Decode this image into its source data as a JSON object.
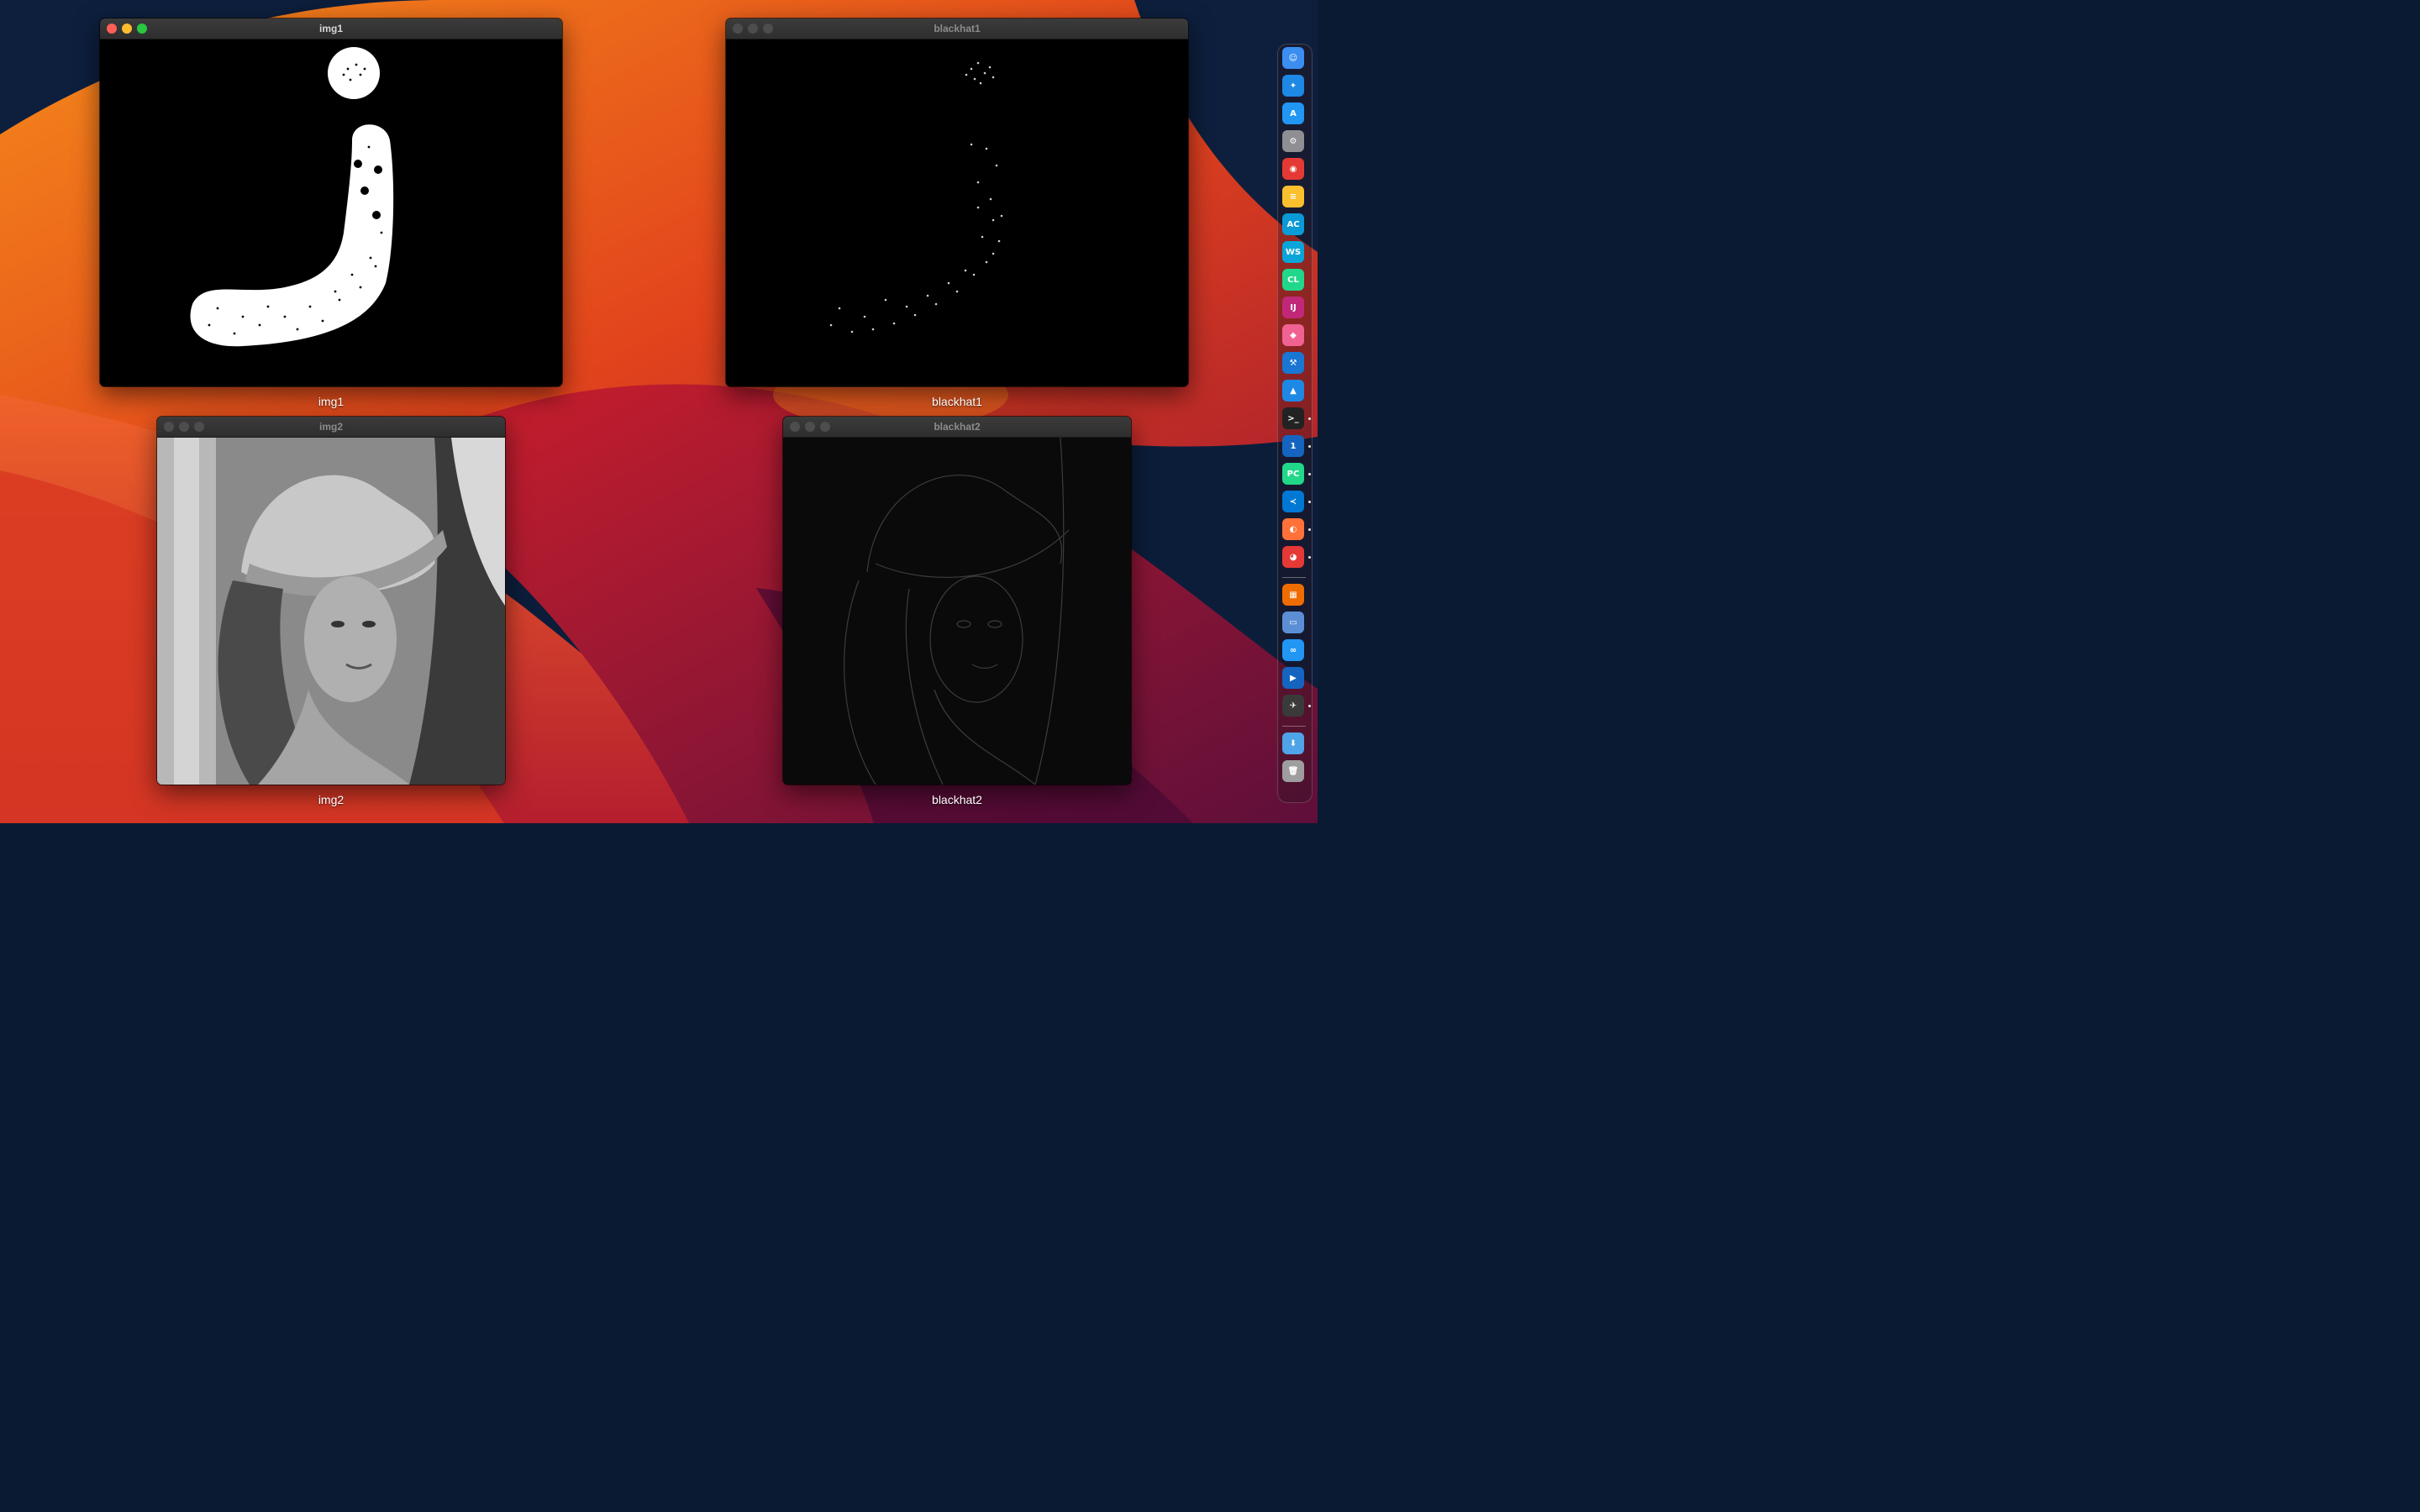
{
  "windows": [
    {
      "id": "img1",
      "title": "img1",
      "caption": "img1",
      "active": true
    },
    {
      "id": "blackhat1",
      "title": "blackhat1",
      "caption": "blackhat1",
      "active": false
    },
    {
      "id": "img2",
      "title": "img2",
      "caption": "img2",
      "active": false
    },
    {
      "id": "blackhat2",
      "title": "blackhat2",
      "caption": "blackhat2",
      "active": false
    }
  ],
  "dock": {
    "apps": [
      {
        "name": "finder",
        "glyph": "☺",
        "color": "#3b8df0",
        "running": false
      },
      {
        "name": "safari",
        "glyph": "✦",
        "color": "#1e88e5",
        "running": false
      },
      {
        "name": "app-store",
        "glyph": "A",
        "color": "#2196f3",
        "running": false
      },
      {
        "name": "system-settings",
        "glyph": "⚙",
        "color": "#8e8e93",
        "running": false
      },
      {
        "name": "chrome",
        "glyph": "◉",
        "color": "#e53935",
        "running": false
      },
      {
        "name": "notes",
        "glyph": "≡",
        "color": "#fbc02d",
        "running": false
      },
      {
        "name": "appcode",
        "glyph": "AC",
        "color": "#0a9ad6",
        "running": false
      },
      {
        "name": "webstorm",
        "glyph": "WS",
        "color": "#0aa5d8",
        "running": false
      },
      {
        "name": "clion",
        "glyph": "CL",
        "color": "#21d789",
        "running": false
      },
      {
        "name": "intellij-idea",
        "glyph": "IJ",
        "color": "#c1287a",
        "running": false
      },
      {
        "name": "cleanmymac",
        "glyph": "◆",
        "color": "#f06292",
        "running": false
      },
      {
        "name": "xcode",
        "glyph": "⚒",
        "color": "#1976d2",
        "running": false
      },
      {
        "name": "mweb",
        "glyph": "▲",
        "color": "#1e88e5",
        "running": false
      },
      {
        "name": "terminal",
        "glyph": ">_",
        "color": "#222222",
        "running": true
      },
      {
        "name": "1password",
        "glyph": "1",
        "color": "#1565c0",
        "running": true
      },
      {
        "name": "pycharm",
        "glyph": "PC",
        "color": "#21d789",
        "running": true
      },
      {
        "name": "vscode",
        "glyph": "≺",
        "color": "#0078d4",
        "running": true
      },
      {
        "name": "firefox",
        "glyph": "◐",
        "color": "#ff7139",
        "running": true
      },
      {
        "name": "pdf-expert",
        "glyph": "◕",
        "color": "#e53935",
        "running": true
      },
      {
        "name": "launchpad",
        "glyph": "▦",
        "color": "#ef6c00",
        "running": false
      },
      {
        "name": "preview",
        "glyph": "▭",
        "color": "#5c8ed6",
        "running": false
      },
      {
        "name": "baidu-netdisk",
        "glyph": "∞",
        "color": "#2196f3",
        "running": false
      },
      {
        "name": "infuse",
        "glyph": "▶",
        "color": "#1565c0",
        "running": false
      },
      {
        "name": "python-launcher",
        "glyph": "✈",
        "color": "#3a3a3a",
        "running": true
      },
      {
        "name": "downloads-folder",
        "glyph": "⬇",
        "color": "#4fa3e8",
        "running": false
      },
      {
        "name": "trash",
        "glyph": "🗑",
        "color": "#9e9e9e",
        "running": false
      }
    ]
  }
}
